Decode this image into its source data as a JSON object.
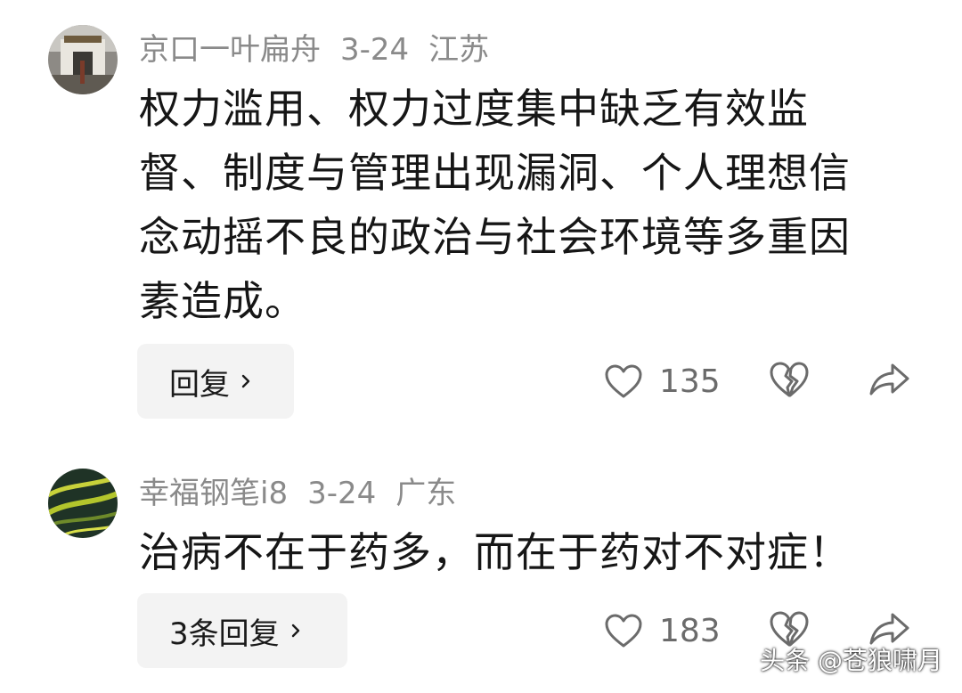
{
  "comments": [
    {
      "user": "京口一叶扁舟",
      "date": "3-24",
      "location": "江苏",
      "text_lines": [
        "权力滥用、权力过度集中缺乏有效监",
        "督、制度与管理出现漏洞、个人理想信",
        "念动摇不良的政治与社会环境等多重因",
        "素造成。"
      ],
      "reply_label": "回复",
      "likes": "135"
    },
    {
      "user": "幸福钢笔i8",
      "date": "3-24",
      "location": "广东",
      "text_lines": [
        "治病不在于药多，而在于药对不对症！"
      ],
      "reply_label": "3条回复",
      "likes": "183"
    }
  ],
  "watermark": "头条 @苍狼啸月",
  "colors": {
    "meta_gray": "#8a8a8a",
    "icon_gray": "#6b6b6b",
    "reply_bg": "#f3f3f3"
  },
  "icons": {
    "like": "heart-outline-icon",
    "dislike": "broken-heart-icon",
    "share": "share-arrow-icon",
    "chevron": "chevron-right-icon"
  }
}
